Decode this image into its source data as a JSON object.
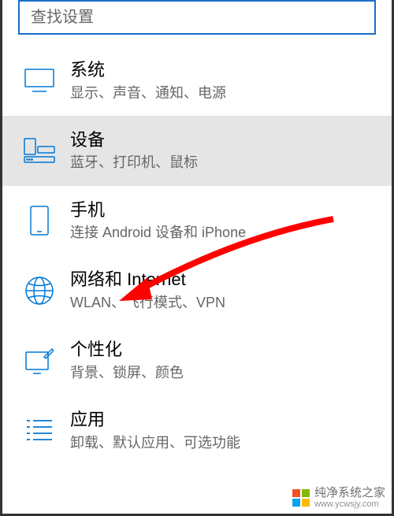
{
  "search": {
    "placeholder": "查找设置"
  },
  "items": [
    {
      "id": "system",
      "title": "系统",
      "subtitle": "显示、声音、通知、电源"
    },
    {
      "id": "devices",
      "title": "设备",
      "subtitle": "蓝牙、打印机、鼠标"
    },
    {
      "id": "phone",
      "title": "手机",
      "subtitle": "连接 Android 设备和 iPhone"
    },
    {
      "id": "network",
      "title": "网络和 Internet",
      "subtitle": "WLAN、飞行模式、VPN"
    },
    {
      "id": "personalize",
      "title": "个性化",
      "subtitle": "背景、锁屏、颜色"
    },
    {
      "id": "apps",
      "title": "应用",
      "subtitle": "卸载、默认应用、可选功能"
    }
  ],
  "selectedIndex": 1,
  "watermark": {
    "text": "纯净系统之家",
    "url": "www.ycwsjy.com"
  },
  "colors": {
    "accent": "#0078d7",
    "searchBorder": "#1a6dc9",
    "selectedBg": "#e5e5e5",
    "arrow": "#ff0000"
  }
}
